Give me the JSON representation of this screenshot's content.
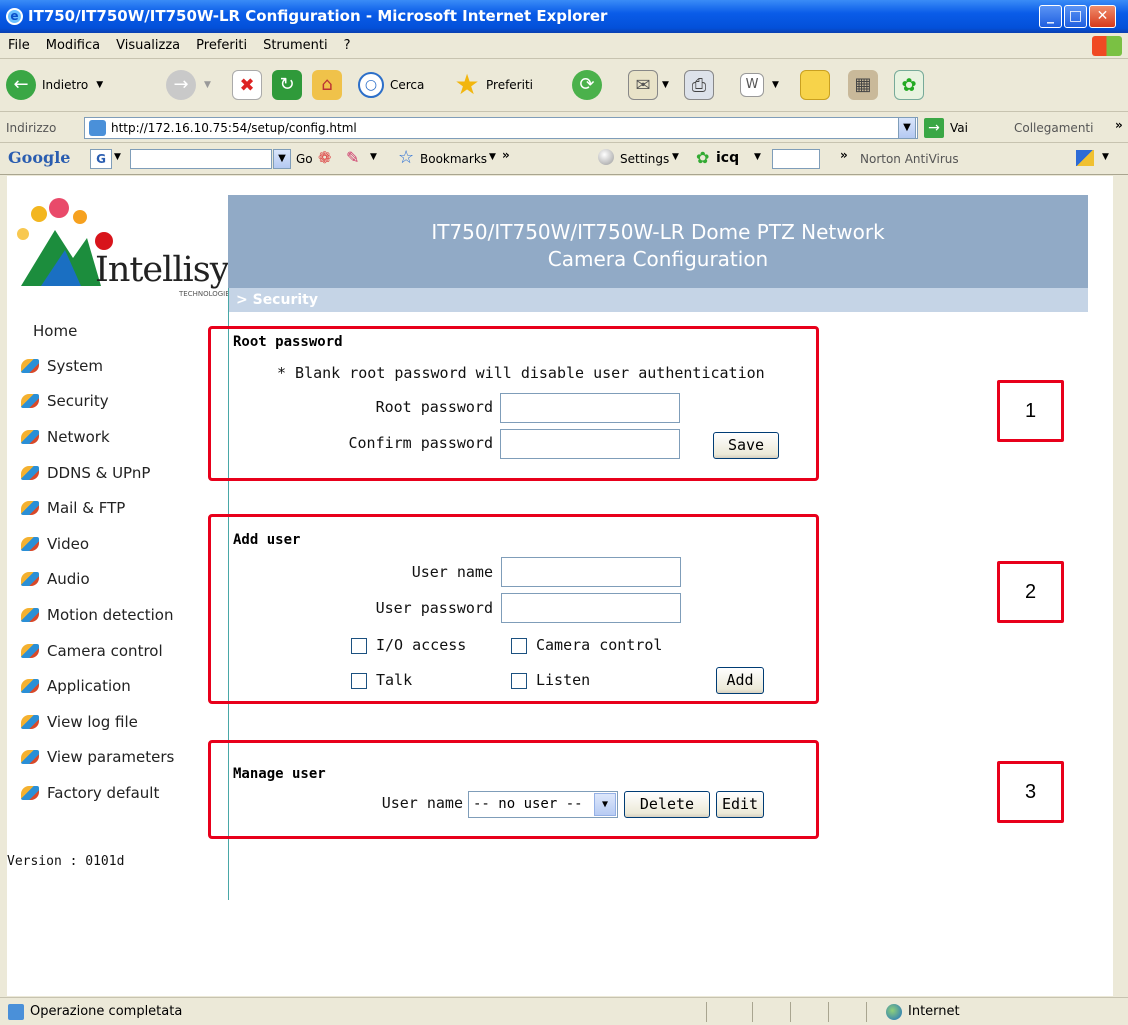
{
  "window": {
    "title": "IT750/IT750W/IT750W-LR Configuration - Microsoft Internet Explorer"
  },
  "menu": [
    "File",
    "Modifica",
    "Visualizza",
    "Preferiti",
    "Strumenti",
    "?"
  ],
  "toolbar": {
    "back": "Indietro",
    "search": "Cerca",
    "favorites": "Preferiti"
  },
  "address": {
    "label": "Indirizzo",
    "url": "http://172.16.10.75:54/setup/config.html",
    "go": "Vai",
    "links": "Collegamenti"
  },
  "googlebar": {
    "brand": "Google",
    "g": "G",
    "go": "Go",
    "bookmarks": "Bookmarks",
    "settings": "Settings",
    "icq": "icq",
    "norton": "Norton AntiVirus"
  },
  "header": {
    "logo": "Intellisystem",
    "logo_sub": "TECHNOLOGIES",
    "title_line1": "IT750/IT750W/IT750W-LR Dome PTZ Network",
    "title_line2": "Camera Configuration",
    "section": "> Security"
  },
  "nav": {
    "items": [
      "Home",
      "System",
      "Security",
      "Network",
      "DDNS & UPnP",
      "Mail & FTP",
      "Video",
      "Audio",
      "Motion detection",
      "Camera control",
      "Application",
      "View log file",
      "View parameters",
      "Factory default"
    ],
    "version": "Version : 0101d"
  },
  "root": {
    "title": "Root password",
    "note": "* Blank root password will disable user authentication",
    "pw_label": "Root password",
    "confirm_label": "Confirm password",
    "save": "Save"
  },
  "adduser": {
    "title": "Add user",
    "name_label": "User name",
    "pw_label": "User password",
    "io": "I/O access",
    "camera": "Camera control",
    "talk": "Talk",
    "listen": "Listen",
    "add": "Add"
  },
  "manage": {
    "title": "Manage user",
    "name_label": "User name",
    "selected": "-- no user --",
    "delete": "Delete",
    "edit": "Edit"
  },
  "callouts": [
    "1",
    "2",
    "3"
  ],
  "status": {
    "text": "Operazione completata",
    "zone": "Internet"
  }
}
